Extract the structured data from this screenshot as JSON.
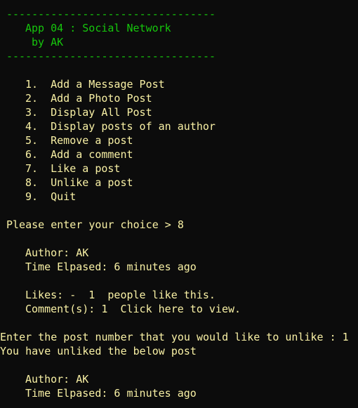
{
  "colors": {
    "background": "#0c0c0c",
    "header_green": "#16c60c",
    "menu_yellow": "#f9f1a5",
    "text_gray": "#cccccc"
  },
  "header": {
    "divider_top": "---------------------------------",
    "title": "App 04 : Social Network",
    "author": "by AK",
    "divider_bottom": "---------------------------------"
  },
  "menu": {
    "items": [
      {
        "number": "1.",
        "label": "Add a Message Post"
      },
      {
        "number": "2.",
        "label": "Add a Photo Post"
      },
      {
        "number": "3.",
        "label": "Display All Post"
      },
      {
        "number": "4.",
        "label": "Display posts of an author"
      },
      {
        "number": "5.",
        "label": "Remove a post"
      },
      {
        "number": "6.",
        "label": "Add a comment"
      },
      {
        "number": "7.",
        "label": "Like a post"
      },
      {
        "number": "8.",
        "label": "Unlike a post"
      },
      {
        "number": "9.",
        "label": "Quit"
      }
    ]
  },
  "prompt": {
    "text": "Please enter your choice > ",
    "value": "8"
  },
  "post_before": {
    "author": "Author: AK",
    "time": "Time Elpased: 6 minutes ago",
    "likes": "Likes: -  1  people like this.",
    "comments": "Comment(s): 1  Click here to view."
  },
  "unlike": {
    "question": "Enter the post number that you would like to unlike : ",
    "answer": "1",
    "confirmation": "You have unliked the below post"
  },
  "post_after": {
    "author": "Author: AK",
    "time": "Time Elpased: 6 minutes ago"
  }
}
